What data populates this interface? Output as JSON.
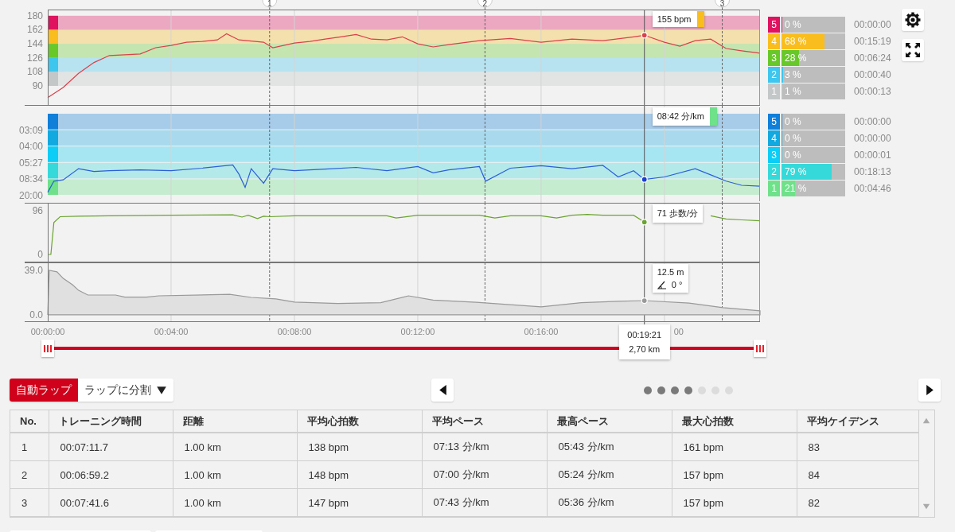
{
  "heart_rate": {
    "chart_data": {
      "type": "line",
      "x": [
        0,
        0.5,
        1,
        1.5,
        2,
        3,
        3.5,
        4,
        4.5,
        5,
        5.5,
        5.8,
        6.2,
        7,
        7.3,
        8,
        8.5,
        9,
        9.5,
        10,
        10.5,
        11,
        11.5,
        12,
        12.5,
        13,
        14,
        15,
        16,
        17,
        18,
        19,
        19.35,
        20,
        20.5,
        21,
        21.5,
        22,
        22.5,
        23.1
      ],
      "series": [
        {
          "color": "#d9404a",
          "values": [
            75,
            88,
            106,
            120,
            129,
            131,
            139,
            142,
            146,
            147,
            149,
            157,
            149,
            146,
            139,
            145,
            147,
            150,
            153,
            156,
            150,
            149,
            153,
            144,
            140,
            143,
            148,
            151,
            146,
            150,
            148,
            153,
            155,
            146,
            141,
            148,
            150,
            138,
            135,
            132
          ]
        }
      ],
      "xlim": [
        0,
        23.1
      ],
      "ylim": [
        64.5,
        188
      ],
      "grid": true,
      "yticks": [
        {
          "value": 90,
          "label": "90"
        },
        {
          "value": 108,
          "label": "108"
        },
        {
          "value": 126,
          "label": "126"
        },
        {
          "value": 144,
          "label": "144"
        },
        {
          "value": 162,
          "label": "162"
        },
        {
          "value": 180,
          "label": "180"
        }
      ],
      "bands": [
        {
          "axis": "y",
          "from": 162,
          "to": 180,
          "color": "#e0115f"
        },
        {
          "axis": "y",
          "from": 144,
          "to": 162,
          "color": "#f9bd1e"
        },
        {
          "axis": "y",
          "from": 126,
          "to": 144,
          "color": "#68c82a"
        },
        {
          "axis": "y",
          "from": 108,
          "to": 126,
          "color": "#3fc6ef"
        },
        {
          "axis": "y",
          "from": 90,
          "to": 108,
          "color": "#c3c7c7"
        }
      ],
      "ref_lines": [
        {
          "axis": "x",
          "value": 7.195
        },
        {
          "axis": "x",
          "value": 14.18
        },
        {
          "axis": "x",
          "value": 21.875
        },
        {
          "axis": "x",
          "value": 19.35
        }
      ]
    },
    "laps": [
      {
        "label": "1"
      },
      {
        "label": "2"
      },
      {
        "label": "3"
      }
    ],
    "cursor_value": "155 bpm",
    "zones": [
      {
        "label": "5",
        "color": "#e0115f",
        "share": "0 %",
        "level": 0,
        "time": "00:00:00"
      },
      {
        "label": "4",
        "color": "#f9bd1e",
        "share": "68 %",
        "level": 0.68,
        "time": "00:15:19"
      },
      {
        "label": "3",
        "color": "#68c82a",
        "share": "28 %",
        "level": 0.28,
        "time": "00:06:24"
      },
      {
        "label": "2",
        "color": "#3fc6ef",
        "share": "3 %",
        "level": 0.03,
        "time": "00:00:40"
      },
      {
        "label": "1",
        "color": "#c3c7c7",
        "share": "1 %",
        "level": 0.01,
        "time": "00:00:13"
      }
    ]
  },
  "pace": {
    "axis_labels": [
      "03:09",
      "04:00",
      "05:27",
      "08:34",
      "20:00"
    ],
    "cursor_value": "08:42 分/km",
    "zones": [
      {
        "label": "5",
        "color": "#0f7fd9",
        "share": "0 %",
        "level": 0,
        "time": "00:00:00"
      },
      {
        "label": "4",
        "color": "#12a8e0",
        "share": "0 %",
        "level": 0,
        "time": "00:00:00"
      },
      {
        "label": "3",
        "color": "#0ccdf5",
        "share": "0 %",
        "level": 0,
        "time": "00:00:01"
      },
      {
        "label": "2",
        "color": "#35d9d9",
        "share": "79 %",
        "level": 0.79,
        "time": "00:18:13"
      },
      {
        "label": "1",
        "color": "#6ee18a",
        "share": "21 %",
        "level": 0.21,
        "time": "00:04:46"
      }
    ]
  },
  "cadence": {
    "chart_data": {
      "type": "line",
      "x": [
        0,
        0.1,
        0.2,
        0.4,
        1,
        2,
        4,
        6,
        6.3,
        6.5,
        6.8,
        7,
        7.2,
        8,
        11,
        11.3,
        12,
        14,
        14.5,
        15,
        16,
        16.5,
        17,
        17.5,
        18,
        19,
        19.35,
        20,
        20.5,
        21,
        21.5,
        22,
        22.5,
        23.1
      ],
      "series": [
        {
          "color": "#6aa330",
          "values": [
            0,
            0,
            70,
            83,
            84,
            85,
            86,
            87,
            82,
            86,
            79,
            84,
            83,
            85,
            85,
            80,
            86,
            86,
            80,
            85,
            85,
            80,
            86,
            88,
            86,
            86,
            71,
            null,
            null,
            null,
            85,
            78,
            76,
            74
          ]
        }
      ],
      "xlim": [
        0,
        23.1
      ],
      "ylim": [
        -17.5,
        113.5
      ],
      "grid": true,
      "yticks": [
        {
          "value": 0,
          "label": "0"
        },
        {
          "value": 96,
          "label": "96"
        }
      ],
      "ref_lines": [
        {
          "axis": "x",
          "value": 7.195
        },
        {
          "axis": "x",
          "value": 14.18
        },
        {
          "axis": "x",
          "value": 21.875
        },
        {
          "axis": "x",
          "value": 19.35
        }
      ]
    },
    "cursor_value": "71 歩数/分"
  },
  "altitude": {
    "chart_data": {
      "type": "area",
      "x": [
        0,
        0.05,
        0.3,
        0.5,
        0.8,
        1,
        1.3,
        2.2,
        2.5,
        3.2,
        3.6,
        5.9,
        6.6,
        7.4,
        8,
        9.4,
        10.8,
        11.7,
        12.5,
        13.9,
        16,
        17.3,
        18.5,
        19.35,
        20.8,
        21.9,
        23.1
      ],
      "series": [
        {
          "color": "#999999",
          "values": [
            0,
            39,
            37.8,
            32,
            26.5,
            21.5,
            17.4,
            17.4,
            15.5,
            15.5,
            16.7,
            18,
            15.3,
            14,
            11.3,
            10,
            10.7,
            16.7,
            13,
            11,
            7,
            10.7,
            12,
            12.5,
            10.4,
            6.3,
            3.5
          ]
        }
      ],
      "xlim": [
        0,
        23.1
      ],
      "ylim": [
        -6.3,
        46
      ],
      "grid": true,
      "xticks": [
        {
          "value": 0,
          "label": "00:00:00"
        },
        {
          "value": 4,
          "label": "00:04:00"
        },
        {
          "value": 8,
          "label": "00:08:00"
        },
        {
          "value": 12,
          "label": "00:12:00"
        },
        {
          "value": 16,
          "label": "00:16:00"
        }
      ],
      "yticks": [
        {
          "value": 0,
          "label": "0.0"
        },
        {
          "value": 39,
          "label": "39.0"
        }
      ],
      "ref_lines": [
        {
          "axis": "x",
          "value": 7.195
        },
        {
          "axis": "x",
          "value": 14.18
        },
        {
          "axis": "x",
          "value": 21.875
        },
        {
          "axis": "x",
          "value": 19.35
        }
      ]
    },
    "cursor_value": "12.5 m",
    "cursor_incline": "0 °",
    "partial_tick_label": "00"
  },
  "cursor_readout": {
    "time": "00:19:21",
    "distance": "2,70 km"
  },
  "range_slider": {
    "handles": [
      {
        "level": 0
      },
      {
        "level": 1
      }
    ]
  },
  "lap_mode": [
    {
      "kind": "toggle",
      "label": "自動ラップ",
      "selected": true
    },
    {
      "kind": "dropdown",
      "label": "ラップに分割",
      "selected": false
    }
  ],
  "pager": [
    {
      "active": true
    },
    {
      "active": true
    },
    {
      "active": true
    },
    {
      "active": true
    },
    {
      "active": false
    },
    {
      "active": false
    },
    {
      "active": false
    }
  ],
  "table": {
    "columns": [
      "No.",
      "トレーニング時間",
      "距離",
      "平均心拍数",
      "平均ペース",
      "最高ペース",
      "最大心拍数",
      "平均ケイデンス"
    ],
    "rows": [
      [
        "1",
        "00:07:11.7",
        "1.00 km",
        "138 bpm",
        "07:13 分/km",
        "05:43 分/km",
        "161 bpm",
        "83"
      ],
      [
        "2",
        "00:06:59.2",
        "1.00 km",
        "148 bpm",
        "07:00 分/km",
        "05:24 分/km",
        "157 bpm",
        "84"
      ],
      [
        "3",
        "00:07:41.6",
        "1.00 km",
        "147 bpm",
        "07:43 分/km",
        "05:36 分/km",
        "157 bpm",
        "82"
      ]
    ]
  }
}
